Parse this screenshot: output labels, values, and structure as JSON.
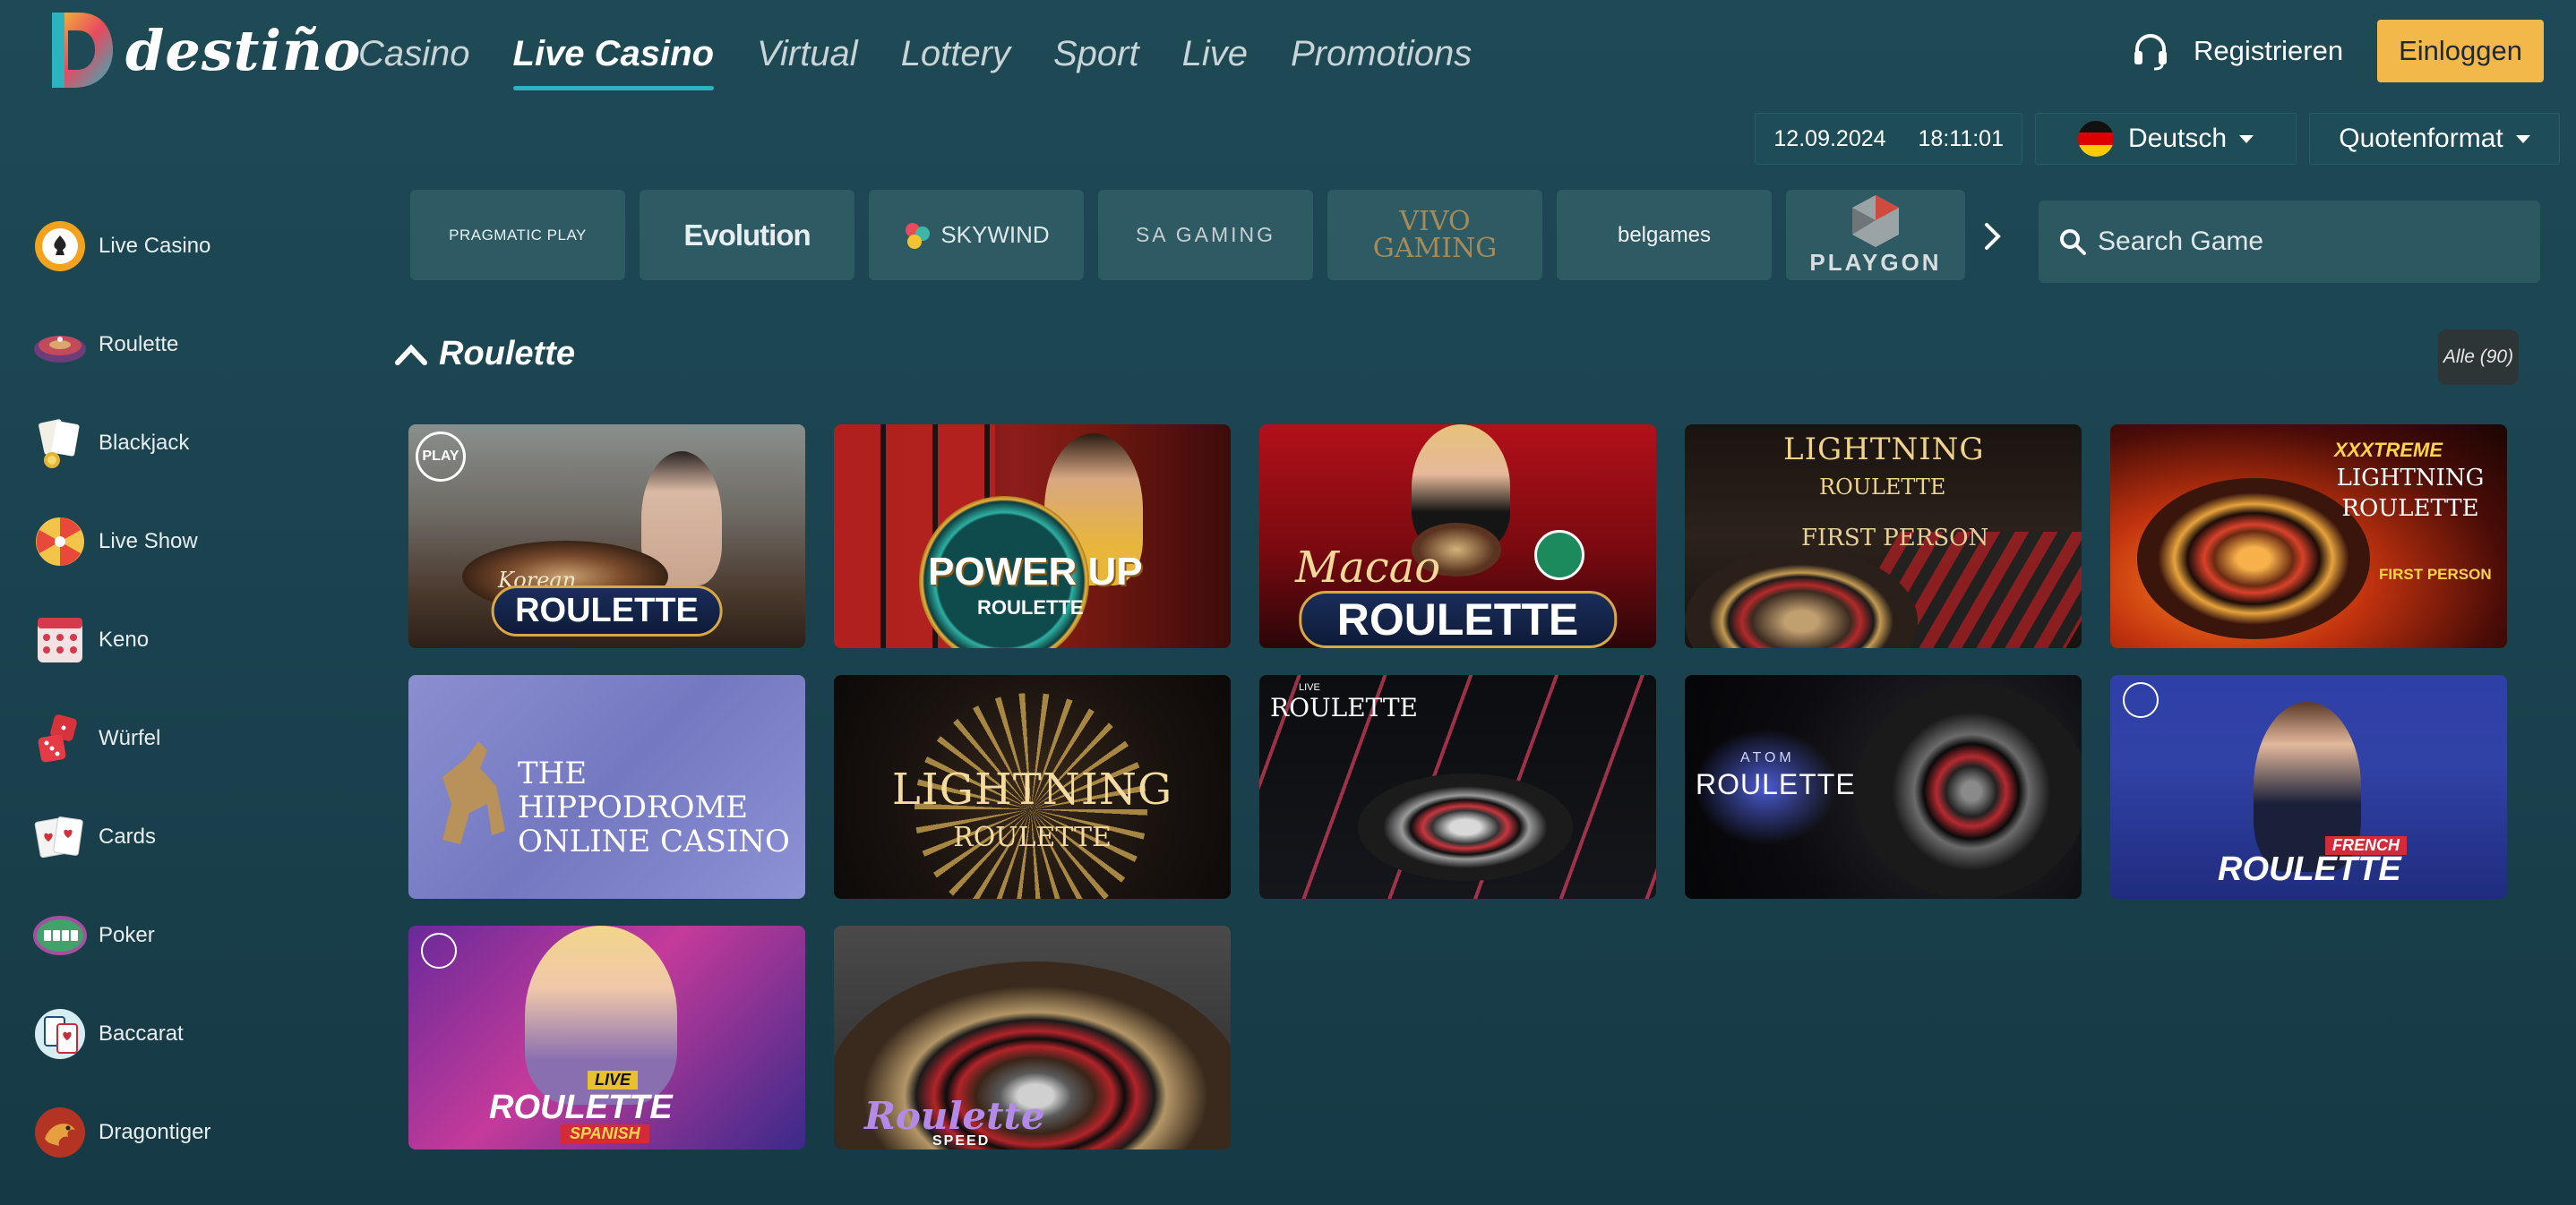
{
  "brand": {
    "name": "destiño"
  },
  "nav": [
    {
      "label": "Casino",
      "active": false
    },
    {
      "label": "Live Casino",
      "active": true
    },
    {
      "label": "Virtual",
      "active": false
    },
    {
      "label": "Lottery",
      "active": false
    },
    {
      "label": "Sport",
      "active": false
    },
    {
      "label": "Live",
      "active": false
    },
    {
      "label": "Promotions",
      "active": false
    }
  ],
  "header": {
    "register_label": "Registrieren",
    "login_label": "Einloggen",
    "support_icon": "headset-icon"
  },
  "subbar": {
    "date": "12.09.2024",
    "time": "18:11:01",
    "language": "Deutsch",
    "odds_format": "Quotenformat"
  },
  "sidebar": [
    {
      "label": "Live Casino",
      "icon": "chip-icon"
    },
    {
      "label": "Roulette",
      "icon": "roulette-icon"
    },
    {
      "label": "Blackjack",
      "icon": "blackjack-icon"
    },
    {
      "label": "Live Show",
      "icon": "wheel-icon"
    },
    {
      "label": "Keno",
      "icon": "keno-icon"
    },
    {
      "label": "Würfel",
      "icon": "dice-icon"
    },
    {
      "label": "Cards",
      "icon": "cards-icon"
    },
    {
      "label": "Poker",
      "icon": "poker-icon"
    },
    {
      "label": "Baccarat",
      "icon": "baccarat-icon"
    },
    {
      "label": "Dragontiger",
      "icon": "dragon-icon"
    }
  ],
  "providers": [
    {
      "name": "PRAGMATIC PLAY"
    },
    {
      "name": "Evolution"
    },
    {
      "name": "SKYWIND"
    },
    {
      "name": "SA GAMING"
    },
    {
      "name": "VIVO GAMING"
    },
    {
      "name": "belgames"
    },
    {
      "name": "PLAYGON"
    }
  ],
  "search": {
    "placeholder": "Search Game"
  },
  "section": {
    "title": "Roulette",
    "all_label": "Alle (90)"
  },
  "games": [
    {
      "name": "Korean Roulette",
      "line1": "Korean",
      "line2": "ROULETTE"
    },
    {
      "name": "Power Up Roulette",
      "line1": "POWER UP",
      "line2": "ROULETTE"
    },
    {
      "name": "Macao Roulette",
      "line1": "Macao",
      "line2": "ROULETTE"
    },
    {
      "name": "Lightning Roulette First Person",
      "line1": "LIGHTNING",
      "line2": "ROULETTE",
      "line3": "FIRST PERSON"
    },
    {
      "name": "XXXtreme Lightning Roulette First Person",
      "line1": "XXXTREME",
      "line2": "LIGHTNING ROULETTE",
      "line3": "FIRST PERSON"
    },
    {
      "name": "The Hippodrome Online Casino",
      "line1": "THE",
      "line2": "HIPPODROME",
      "line3": "ONLINE CASINO"
    },
    {
      "name": "Lightning Roulette",
      "line1": "LIGHTNING",
      "line2": "ROULETTE"
    },
    {
      "name": "Live Roulette",
      "line1": "LIVE",
      "line2": "ROULETTE"
    },
    {
      "name": "Atom Roulette",
      "line1": "ATOM",
      "line2": "ROULETTE"
    },
    {
      "name": "French Roulette",
      "line1": "FRENCH",
      "line2": "ROULETTE"
    },
    {
      "name": "Live Roulette Spanish",
      "line1": "LIVE",
      "line2": "ROULETTE",
      "line3": "SPANISH"
    },
    {
      "name": "Roulette Speed",
      "line1": "Roulette",
      "line2": "SPEED"
    }
  ]
}
